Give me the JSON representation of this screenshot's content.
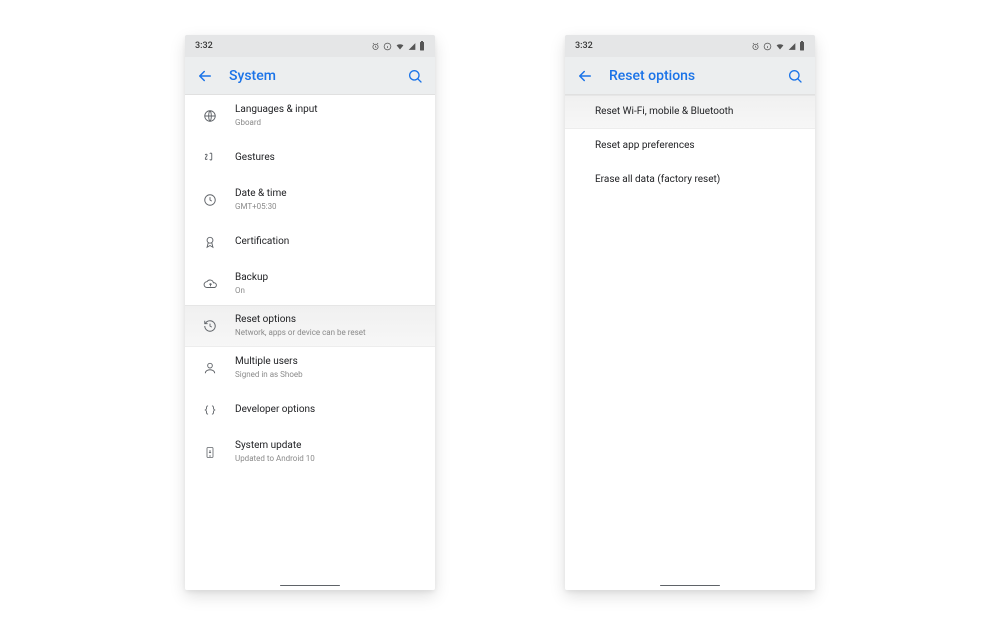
{
  "status": {
    "time": "3:32"
  },
  "accent": "#1a73e8",
  "screen1": {
    "title": "System",
    "items": [
      {
        "title": "Languages & input",
        "sub": "Gboard",
        "icon": "globe"
      },
      {
        "title": "Gestures",
        "sub": "",
        "icon": "gesture"
      },
      {
        "title": "Date & time",
        "sub": "GMT+05:30",
        "icon": "clock"
      },
      {
        "title": "Certification",
        "sub": "",
        "icon": "cert"
      },
      {
        "title": "Backup",
        "sub": "On",
        "icon": "cloud"
      },
      {
        "title": "Reset options",
        "sub": "Network, apps or device can be reset",
        "icon": "restore",
        "highlight": true
      },
      {
        "title": "Multiple users",
        "sub": "Signed in as Shoeb",
        "icon": "user"
      },
      {
        "title": "Developer options",
        "sub": "",
        "icon": "dev"
      },
      {
        "title": "System update",
        "sub": "Updated to Android 10",
        "icon": "update"
      }
    ]
  },
  "screen2": {
    "title": "Reset options",
    "items": [
      {
        "title": "Reset Wi-Fi, mobile & Bluetooth",
        "highlight": true
      },
      {
        "title": "Reset app preferences"
      },
      {
        "title": "Erase all data (factory reset)"
      }
    ]
  }
}
